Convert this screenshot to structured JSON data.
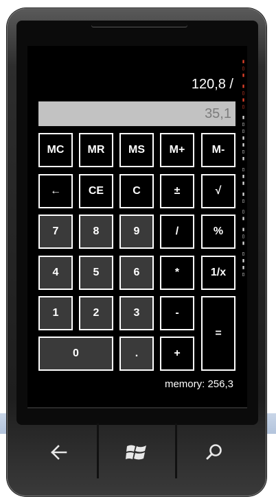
{
  "calculator": {
    "expression": "120,8 /",
    "display_value": "35,1",
    "memory_text": "memory: 256,3",
    "memory_row": [
      "MC",
      "MR",
      "MS",
      "M+",
      "M-"
    ],
    "function_row": [
      "←",
      "CE",
      "C",
      "±",
      "√"
    ],
    "row_789": [
      "7",
      "8",
      "9",
      "/",
      "%"
    ],
    "row_456": [
      "4",
      "5",
      "6",
      "*",
      "1/x"
    ],
    "row_123": [
      "1",
      "2",
      "3",
      "-"
    ],
    "equals": "=",
    "zero": "0",
    "decimal": ".",
    "plus": "+"
  },
  "hardware_buttons": {
    "back": "back-arrow-icon",
    "start": "windows-logo-icon",
    "search": "search-icon"
  },
  "colors": {
    "screen": "#000000",
    "display_bg": "#c2c2c2",
    "display_text": "#7c7c7c",
    "key_border": "#ffffff",
    "number_key_bg": "#3a3a3a"
  }
}
